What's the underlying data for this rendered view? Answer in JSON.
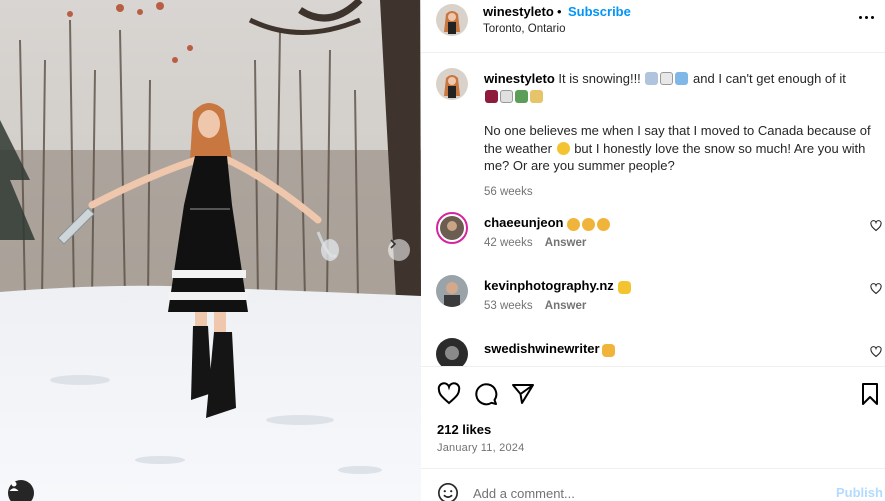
{
  "post": {
    "username": "winestyleto",
    "separator": "•",
    "subscribe_label": "Subscribe",
    "location": "Toronto, Ontario",
    "more_icon": "more-horizontal-icon"
  },
  "caption": {
    "username": "winestyleto",
    "line1": "It is snowing!!!",
    "line1_tail": "and I can't get enough of it",
    "paragraph": "No one believes me when I say that I moved to Canada because of the weather",
    "paragraph_tail": "but I honestly love the snow so much! Are you with me? Or are you summer people?",
    "time": "56 weeks"
  },
  "comments": [
    {
      "username": "chaeeunjeon",
      "time": "42 weeks",
      "answer": "Answer",
      "emoji": "clap x3"
    },
    {
      "username": "kevinphotography.nz",
      "time": "53 weeks",
      "answer": "Answer",
      "emoji": "thumbs-up"
    },
    {
      "username": "swedishwinewriter",
      "emoji": "raised-hands"
    }
  ],
  "actions": {
    "likes": "212 likes",
    "date": "January 11, 2024"
  },
  "add_comment": {
    "placeholder": "Add a comment...",
    "publish_label": "Publish"
  },
  "colors": {
    "link": "#0095f6",
    "publish_disabled": "#b3dbff",
    "secondary_text": "#737373",
    "divider": "#efefef"
  }
}
